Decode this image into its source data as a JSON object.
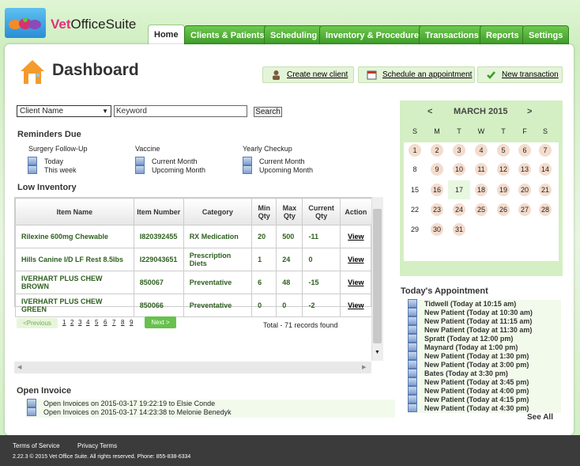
{
  "brand": {
    "name_colored": "Vet",
    "name_rest": "OfficeSuite"
  },
  "tabs": [
    {
      "label": "Home",
      "active": true
    },
    {
      "label": "Clients & Patients"
    },
    {
      "label": "Scheduling"
    },
    {
      "label": "Inventory & Procedures"
    },
    {
      "label": "Transactions"
    },
    {
      "label": "Reports"
    },
    {
      "label": "Settings"
    }
  ],
  "page_title": "Dashboard",
  "quick_actions": {
    "create_client": "Create new client",
    "schedule": "Schedule an appointment",
    "transaction": "New transaction"
  },
  "search": {
    "select_value": "Client Name",
    "keyword_placeholder": "Keyword",
    "button": "Search"
  },
  "reminders": {
    "title": "Reminders Due",
    "groups": [
      {
        "name": "Surgery Follow-Up",
        "items": [
          "Today",
          "This week"
        ]
      },
      {
        "name": "Vaccine",
        "items": [
          "Current Month",
          "Upcoming Month"
        ]
      },
      {
        "name": "Yearly Checkup",
        "items": [
          "Current Month",
          "Upcoming Month"
        ]
      }
    ]
  },
  "low_inventory": {
    "title": "Low Inventory",
    "headers": [
      "Item Name",
      "Item Number",
      "Category",
      "Min Qty",
      "Max Qty",
      "Current Qty",
      "Action"
    ],
    "rows": [
      [
        "Rilexine 600mg Chewable",
        "I820392455",
        "RX Medication",
        "20",
        "500",
        "-11",
        "View"
      ],
      [
        "Hills Canine I/D LF Rest 8.5lbs",
        "I229043651",
        "Prescription Diets",
        "1",
        "24",
        "0",
        "View"
      ],
      [
        "IVERHART PLUS CHEW BROWN",
        "850067",
        "Preventative",
        "6",
        "48",
        "-15",
        "View"
      ],
      [
        "IVERHART PLUS CHEW GREEN",
        "850066",
        "Preventative",
        "0",
        "0",
        "-2",
        "View"
      ]
    ],
    "prev": "<Previous",
    "pages": [
      "1",
      "2",
      "3",
      "4",
      "5",
      "6",
      "7",
      "8",
      "9"
    ],
    "next": "Next >",
    "total": "Total - 71 records found"
  },
  "open_invoice": {
    "title": "Open Invoice",
    "items": [
      "Open Invoices on 2015-03-17 19:22:19 to Elsie Conde",
      "Open Invoices on 2015-03-17 14:23:38 to Melonie Benedyk"
    ]
  },
  "calendar": {
    "month": "MARCH 2015",
    "prev": "<",
    "next": ">",
    "dow": [
      "S",
      "M",
      "T",
      "W",
      "T",
      "F",
      "S"
    ],
    "weeks": [
      [
        "1",
        "2",
        "3",
        "4",
        "5",
        "6",
        "7"
      ],
      [
        "8",
        "9",
        "10",
        "11",
        "12",
        "13",
        "14"
      ],
      [
        "15",
        "16",
        "17",
        "18",
        "19",
        "20",
        "21"
      ],
      [
        "22",
        "23",
        "24",
        "25",
        "26",
        "27",
        "28"
      ],
      [
        "29",
        "30",
        "31",
        "",
        "",
        "",
        ""
      ]
    ],
    "today": "17"
  },
  "appointments": {
    "title": "Today's Appointment",
    "items": [
      "Tidwell (Today at 10:15 am)",
      "New Patient (Today at 10:30 am)",
      "New Patient (Today at 11:15 am)",
      "New Patient (Today at 11:30 am)",
      "Spratt (Today at 12:00 pm)",
      "Maynard (Today at 1:00 pm)",
      "New Patient (Today at 1:30 pm)",
      "New Patient (Today at 3:00 pm)",
      "Bates (Today at 3:30 pm)",
      "New Patient (Today at 3:45 pm)",
      "New Patient (Today at 4:00 pm)",
      "New Patient (Today at 4:15 pm)",
      "New Patient (Today at 4:30 pm)"
    ],
    "see_all": "See All"
  },
  "footer": {
    "terms": "Terms of Service",
    "privacy": "Privacy Terms",
    "copyright": "2.22.3 © 2015 Vet Office Suite. All rights reserved. Phone: 855-838-6334"
  },
  "colors": {
    "accent": "#4caf32",
    "panel_bg": "#ffffff",
    "footer_bg": "#3b3b3b",
    "calendar_bg": "#d4efc4",
    "day_circle": "#f4dccd"
  }
}
